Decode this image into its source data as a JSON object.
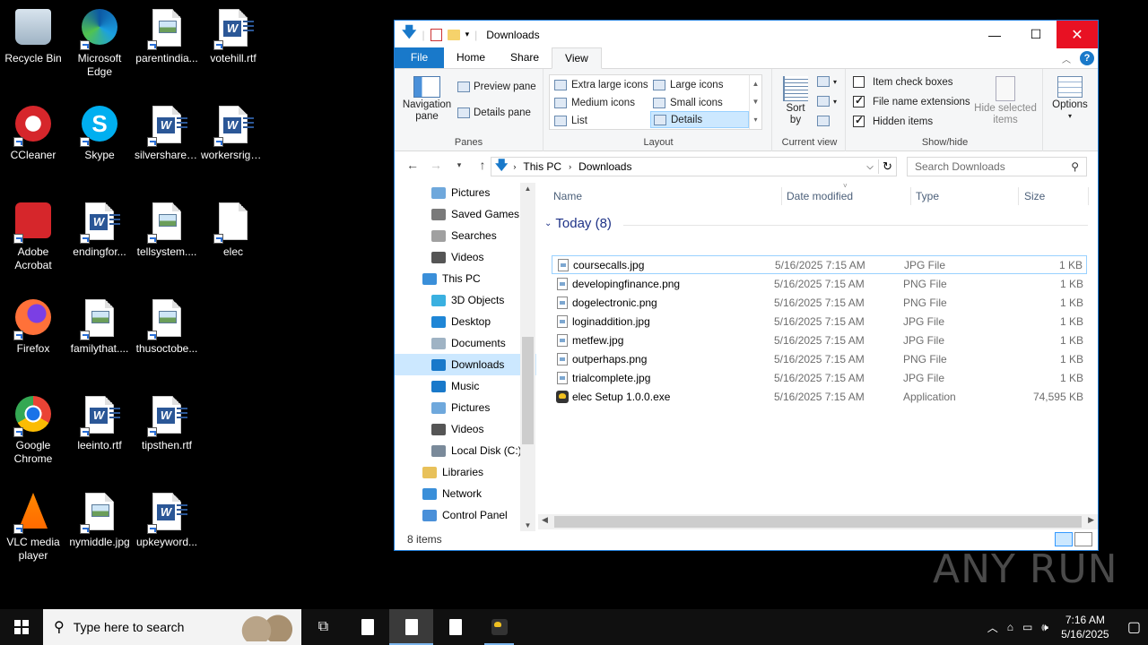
{
  "desktop_icons": [
    {
      "label": "Recycle Bin",
      "icon": "recycle-bin-icon"
    },
    {
      "label": "Microsoft Edge",
      "icon": "edge-icon"
    },
    {
      "label": "parentindia...",
      "icon": "image-file-icon"
    },
    {
      "label": "votehill.rtf",
      "icon": "word-doc-icon"
    },
    {
      "label": "CCleaner",
      "icon": "ccleaner-icon"
    },
    {
      "label": "Skype",
      "icon": "skype-icon"
    },
    {
      "label": "silvershare.rtf",
      "icon": "word-doc-icon"
    },
    {
      "label": "workersrigh...",
      "icon": "word-doc-icon"
    },
    {
      "label": "Adobe Acrobat",
      "icon": "acrobat-icon"
    },
    {
      "label": "endingfor...",
      "icon": "word-doc-icon"
    },
    {
      "label": "tellsystem....",
      "icon": "image-file-icon"
    },
    {
      "label": "elec",
      "icon": "blank-file-icon"
    },
    {
      "label": "Firefox",
      "icon": "firefox-icon"
    },
    {
      "label": "familythat....",
      "icon": "image-file-icon"
    },
    {
      "label": "thusoctobe...",
      "icon": "image-file-icon"
    },
    {
      "label": "Google Chrome",
      "icon": "chrome-icon"
    },
    {
      "label": "leeinto.rtf",
      "icon": "word-doc-icon"
    },
    {
      "label": "tipsthen.rtf",
      "icon": "word-doc-icon"
    },
    {
      "label": "VLC media player",
      "icon": "vlc-icon"
    },
    {
      "label": "nymiddle.jpg",
      "icon": "image-file-icon"
    },
    {
      "label": "upkeyword...",
      "icon": "word-doc-icon"
    }
  ],
  "window": {
    "title": "Downloads",
    "tabs": {
      "file": "File",
      "home": "Home",
      "share": "Share",
      "view": "View"
    },
    "ribbon": {
      "panes": {
        "navigation_pane": "Navigation pane",
        "preview_pane": "Preview pane",
        "details_pane": "Details pane",
        "label": "Panes"
      },
      "layout": {
        "items": [
          "Extra large icons",
          "Large icons",
          "Medium icons",
          "Small icons",
          "List",
          "Details"
        ],
        "selected": "Details",
        "label": "Layout"
      },
      "current_view": {
        "sort_by": "Sort by",
        "label": "Current view"
      },
      "show_hide": {
        "item_check_boxes": "Item check boxes",
        "file_name_extensions": "File name extensions",
        "hidden_items": "Hidden items",
        "hide_selected_items": "Hide selected items",
        "label": "Show/hide",
        "checks": {
          "item_check_boxes": false,
          "file_name_extensions": true,
          "hidden_items": true
        }
      },
      "options": "Options"
    },
    "address": {
      "segments": [
        "This PC",
        "Downloads"
      ]
    },
    "search_placeholder": "Search Downloads",
    "nav_items": [
      {
        "label": "Pictures",
        "indent": 1,
        "icon": "pictures-icon"
      },
      {
        "label": "Saved Games",
        "indent": 1,
        "icon": "saved-games-icon"
      },
      {
        "label": "Searches",
        "indent": 1,
        "icon": "searches-icon"
      },
      {
        "label": "Videos",
        "indent": 1,
        "icon": "videos-icon"
      },
      {
        "label": "This PC",
        "indent": 0,
        "icon": "this-pc-icon"
      },
      {
        "label": "3D Objects",
        "indent": 1,
        "icon": "3d-objects-icon"
      },
      {
        "label": "Desktop",
        "indent": 1,
        "icon": "desktop-folder-icon"
      },
      {
        "label": "Documents",
        "indent": 1,
        "icon": "documents-icon"
      },
      {
        "label": "Downloads",
        "indent": 1,
        "icon": "downloads-icon",
        "selected": true
      },
      {
        "label": "Music",
        "indent": 1,
        "icon": "music-icon"
      },
      {
        "label": "Pictures",
        "indent": 1,
        "icon": "pictures-icon"
      },
      {
        "label": "Videos",
        "indent": 1,
        "icon": "videos-icon"
      },
      {
        "label": "Local Disk (C:)",
        "indent": 1,
        "icon": "local-disk-icon"
      },
      {
        "label": "Libraries",
        "indent": 0,
        "icon": "libraries-icon"
      },
      {
        "label": "Network",
        "indent": 0,
        "icon": "network-icon"
      },
      {
        "label": "Control Panel",
        "indent": 0,
        "icon": "control-panel-icon"
      }
    ],
    "columns": {
      "name": "Name",
      "date": "Date modified",
      "type": "Type",
      "size": "Size"
    },
    "group_header": "Today (8)",
    "files": [
      {
        "name": "coursecalls.jpg",
        "date": "5/16/2025 7:15 AM",
        "type": "JPG File",
        "size": "1 KB"
      },
      {
        "name": "developingfinance.png",
        "date": "5/16/2025 7:15 AM",
        "type": "PNG File",
        "size": "1 KB"
      },
      {
        "name": "dogelectronic.png",
        "date": "5/16/2025 7:15 AM",
        "type": "PNG File",
        "size": "1 KB"
      },
      {
        "name": "loginaddition.jpg",
        "date": "5/16/2025 7:15 AM",
        "type": "JPG File",
        "size": "1 KB"
      },
      {
        "name": "metfew.jpg",
        "date": "5/16/2025 7:15 AM",
        "type": "JPG File",
        "size": "1 KB"
      },
      {
        "name": "outperhaps.png",
        "date": "5/16/2025 7:15 AM",
        "type": "PNG File",
        "size": "1 KB"
      },
      {
        "name": "trialcomplete.jpg",
        "date": "5/16/2025 7:15 AM",
        "type": "JPG File",
        "size": "1 KB"
      },
      {
        "name": "elec Setup 1.0.0.exe",
        "date": "5/16/2025 7:15 AM",
        "type": "Application",
        "size": "74,595 KB"
      }
    ],
    "status": "8 items"
  },
  "taskbar": {
    "search_placeholder": "Type here to search",
    "time": "7:16 AM",
    "date": "5/16/2025"
  },
  "watermark": "ANY RUN",
  "colors": {
    "accent": "#1979ca",
    "close": "#e81123",
    "selection": "#cce8ff"
  }
}
